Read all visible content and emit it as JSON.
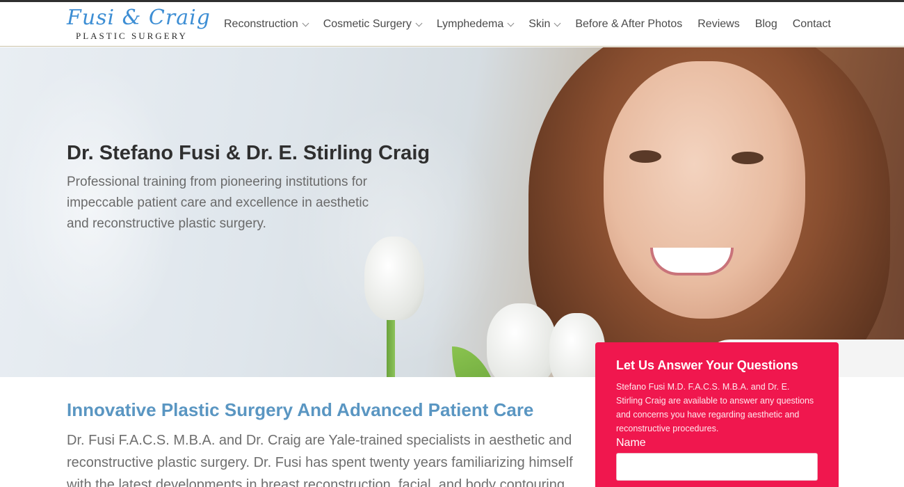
{
  "brand": {
    "script": "Fusi & Craig",
    "subtitle": "PLASTIC SURGERY"
  },
  "nav": {
    "items": [
      {
        "label": "Reconstruction",
        "dropdown": true
      },
      {
        "label": "Cosmetic Surgery",
        "dropdown": true
      },
      {
        "label": "Lymphedema",
        "dropdown": true
      },
      {
        "label": "Skin",
        "dropdown": true
      },
      {
        "label": "Before & After Photos",
        "dropdown": false
      },
      {
        "label": "Reviews",
        "dropdown": false
      },
      {
        "label": "Blog",
        "dropdown": false
      },
      {
        "label": "Contact",
        "dropdown": false
      }
    ]
  },
  "hero": {
    "title": "Dr. Stefano Fusi & Dr. E. Stirling Craig",
    "subtitle": "Professional training from pioneering institutions for impeccable patient care and excellence in aesthetic and reconstructive plastic surgery."
  },
  "content": {
    "heading": "Innovative Plastic Surgery And Advanced Patient Care",
    "body": "Dr. Fusi F.A.C.S. M.B.A. and Dr. Craig are Yale-trained specialists in aesthetic and reconstructive plastic surgery. Dr. Fusi has spent twenty years familiarizing himself with the latest developments in breast reconstruction, facial, and body contouring"
  },
  "form": {
    "title": "Let Us Answer Your Questions",
    "description": "Stefano Fusi M.D. F.A.C.S. M.B.A. and Dr. E. Stirling Craig are available to answer any questions and concerns you have regarding aesthetic and reconstructive procedures.",
    "name_label": "Name",
    "name_value": ""
  },
  "colors": {
    "brand_blue": "#3d8ed4",
    "heading_blue": "#5a96c2",
    "form_red": "#f0174e",
    "nav_text": "#4a4a4a"
  }
}
